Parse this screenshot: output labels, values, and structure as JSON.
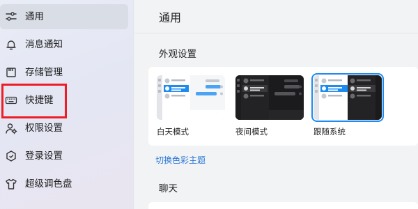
{
  "sidebar": {
    "items": [
      {
        "label": "通用",
        "icon": "sliders-icon",
        "active": true
      },
      {
        "label": "消息通知",
        "icon": "bell-icon",
        "active": false
      },
      {
        "label": "存储管理",
        "icon": "storage-icon",
        "active": false
      },
      {
        "label": "快捷键",
        "icon": "keyboard-icon",
        "active": false
      },
      {
        "label": "权限设置",
        "icon": "user-permission-icon",
        "active": false
      },
      {
        "label": "登录设置",
        "icon": "shield-icon",
        "active": false
      },
      {
        "label": "超级调色盘",
        "icon": "shirt-icon",
        "active": false
      }
    ]
  },
  "main": {
    "title": "通用",
    "appearance": {
      "title": "外观设置",
      "themes": [
        {
          "label": "白天模式",
          "id": "light",
          "selected": false
        },
        {
          "label": "夜间模式",
          "id": "dark",
          "selected": false
        },
        {
          "label": "跟随系统",
          "id": "system",
          "selected": true
        }
      ],
      "switch_theme_link": "切换色彩主题"
    },
    "chat": {
      "title": "聊天"
    }
  },
  "colors": {
    "accent": "#1d8cf0",
    "link": "#2a78d6",
    "highlight": "#ee1c25",
    "active_nav": "#d9dde6"
  }
}
